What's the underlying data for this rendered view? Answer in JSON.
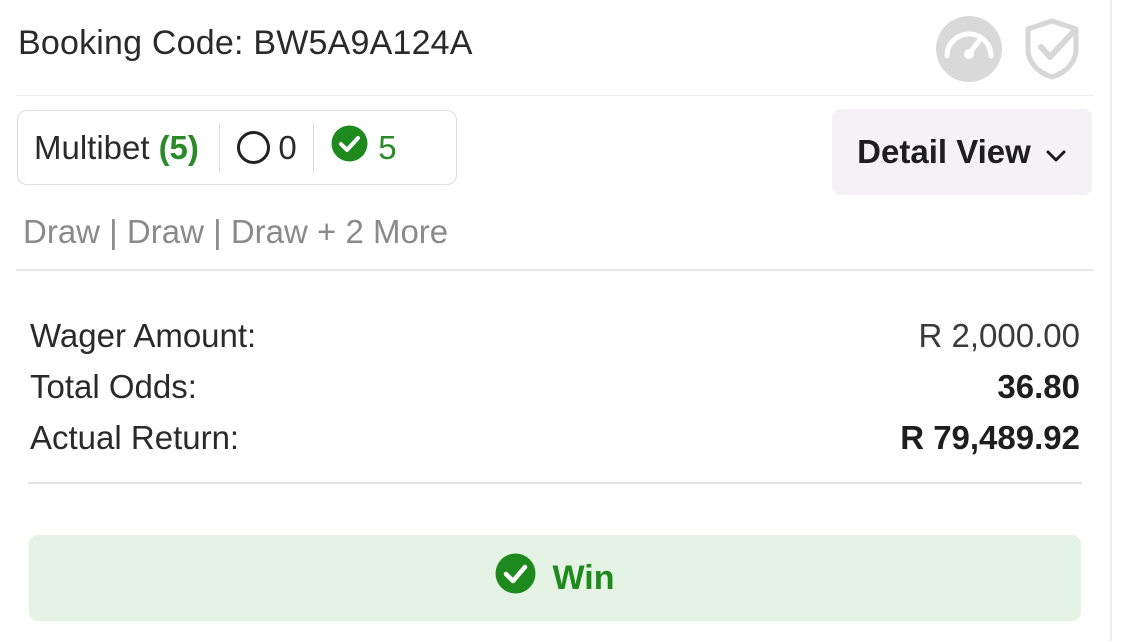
{
  "header": {
    "booking_label": "Booking Code:",
    "booking_code": "BW5A9A124A",
    "icons": [
      "gauge-icon",
      "shield-check-icon"
    ]
  },
  "bet_summary": {
    "type_label": "Multibet",
    "type_count": "(5)",
    "open_count": "0",
    "won_count": "5"
  },
  "view_toggle": {
    "label": "Detail View"
  },
  "selections_text": "Draw | Draw | Draw + 2 More",
  "amounts": {
    "wager_label": "Wager Amount:",
    "wager_value": "R 2,000.00",
    "odds_label": "Total Odds:",
    "odds_value": "36.80",
    "return_label": "Actual Return:",
    "return_value": "R 79,489.92"
  },
  "result": {
    "label": "Win"
  },
  "colors": {
    "accent_green": "#1e8a1e",
    "win_background": "#e5f3e4",
    "muted_icon": "#d7d7d7"
  }
}
